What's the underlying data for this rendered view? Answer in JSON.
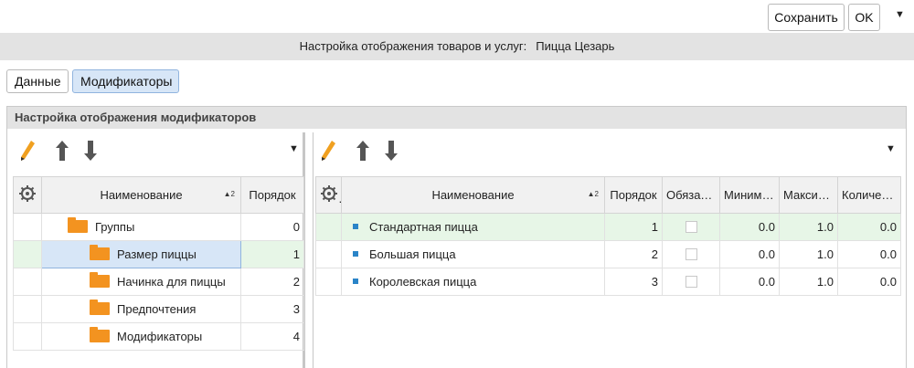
{
  "toolbar": {
    "save_label": "Сохранить",
    "ok_label": "OK"
  },
  "header": {
    "title_prefix": "Настройка отображения товаров и услуг:",
    "title_item": "Пицца Цезарь"
  },
  "tabs": [
    {
      "label": "Данные"
    },
    {
      "label": "Модификаторы"
    }
  ],
  "section": {
    "title": "Настройка отображения модификаторов"
  },
  "left_table": {
    "columns": {
      "name": "Наименование",
      "order": "Порядок",
      "sort_badge": "▲2"
    },
    "rows": [
      {
        "name": "Группы",
        "order": "0"
      },
      {
        "name": "Размер пиццы",
        "order": "1"
      },
      {
        "name": "Начинка для пиццы",
        "order": "2"
      },
      {
        "name": "Предпочтения",
        "order": "3"
      },
      {
        "name": "Модификаторы",
        "order": "4"
      }
    ]
  },
  "right_table": {
    "columns": {
      "name": "Наименование",
      "order": "Порядок",
      "required": "Обязательный",
      "min": "Минимум",
      "max": "Максимум",
      "qty": "Количество",
      "sort_badge": "▲2"
    },
    "rows": [
      {
        "name": "Стандартная пицца",
        "order": "1",
        "min": "0.0",
        "max": "1.0",
        "qty": "0.0"
      },
      {
        "name": "Большая пицца",
        "order": "2",
        "min": "0.0",
        "max": "1.0",
        "qty": "0.0"
      },
      {
        "name": "Королевская пицца",
        "order": "3",
        "min": "0.0",
        "max": "1.0",
        "qty": "0.0"
      }
    ]
  },
  "icons": {
    "edit": "pencil-icon",
    "move_up": "arrow-up-icon",
    "move_down": "arrow-down-icon",
    "settings": "gear-icon",
    "folder": "folder-icon"
  },
  "colors": {
    "accent_tab": "#d7e6f7",
    "folder": "#f39320",
    "highlight_row": "#e7f6e7",
    "bullet": "#2a84c8",
    "pencil": "#f0a020"
  }
}
